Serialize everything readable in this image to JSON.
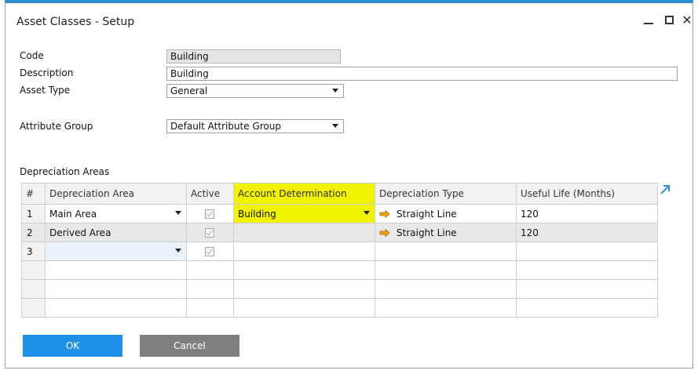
{
  "window": {
    "title": "Asset Classes - Setup"
  },
  "form": {
    "code_label": "Code",
    "code_value": "Building",
    "description_label": "Description",
    "description_value": "Building",
    "asset_type_label": "Asset Type",
    "asset_type_value": "General",
    "attribute_group_label": "Attribute Group",
    "attribute_group_value": "Default Attribute Group"
  },
  "depreciation": {
    "section_label": "Depreciation Areas",
    "columns": [
      "#",
      "Depreciation Area",
      "Active",
      "Account Determination",
      "Depreciation Type",
      "Useful Life (Months)"
    ],
    "rows": [
      {
        "num": "1",
        "area": "Main Area",
        "active": true,
        "account": "Building",
        "type": "Straight Line",
        "life": "120"
      },
      {
        "num": "2",
        "area": "Derived Area",
        "active": true,
        "account": "",
        "type": "Straight Line",
        "life": "120"
      },
      {
        "num": "3",
        "area": "",
        "active": true,
        "account": "",
        "type": "",
        "life": ""
      }
    ]
  },
  "buttons": {
    "ok": "OK",
    "cancel": "Cancel"
  },
  "colors": {
    "accent": "#1e90e8",
    "highlight": "#f2f300",
    "cancel": "#7f7f7f",
    "link_arrow": "#e8a317"
  }
}
